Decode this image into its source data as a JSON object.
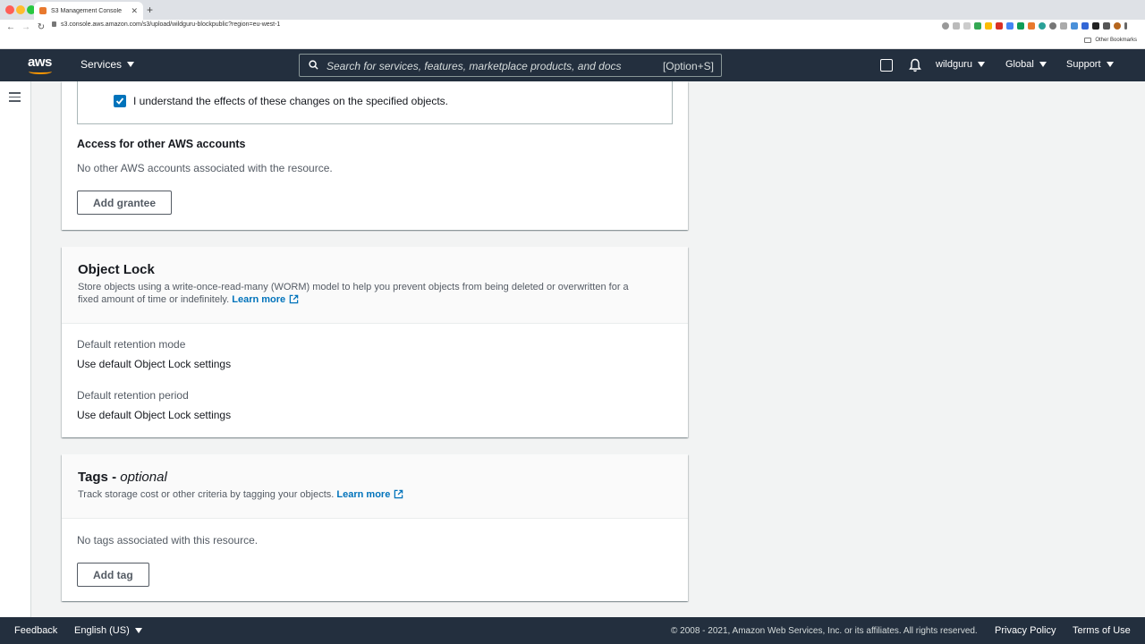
{
  "browser": {
    "tab_title": "S3 Management Console",
    "url": "s3.console.aws.amazon.com/s3/upload/wildguru-blockpublic?region=eu-west-1",
    "bookmarks_label": "Other Bookmarks"
  },
  "aws_nav": {
    "logo_text": "aws",
    "services_label": "Services",
    "search_placeholder": "Search for services, features, marketplace products, and docs",
    "search_shortcut": "[Option+S]",
    "account_label": "wildguru",
    "region_label": "Global",
    "support_label": "Support"
  },
  "acl_section": {
    "ack_checkbox_label": "I understand the effects of these changes on the specified objects.",
    "ack_checked": true,
    "other_accounts_heading": "Access for other AWS accounts",
    "other_accounts_empty": "No other AWS accounts associated with the resource.",
    "add_grantee_label": "Add grantee"
  },
  "object_lock": {
    "title": "Object Lock",
    "description": "Store objects using a write-once-read-many (WORM) model to help you prevent objects from being deleted or overwritten for a fixed amount of time or indefinitely.",
    "learn_more": "Learn more",
    "retention_mode_label": "Default retention mode",
    "retention_mode_value": "Use default Object Lock settings",
    "retention_period_label": "Default retention period",
    "retention_period_value": "Use default Object Lock settings"
  },
  "tags": {
    "title": "Tags - ",
    "title_optional": "optional",
    "description": "Track storage cost or other criteria by tagging your objects.",
    "learn_more": "Learn more",
    "empty": "No tags associated with this resource.",
    "add_tag_label": "Add tag"
  },
  "footer": {
    "feedback": "Feedback",
    "language": "English (US)",
    "copyright": "© 2008 - 2021, Amazon Web Services, Inc. or its affiliates. All rights reserved.",
    "privacy": "Privacy Policy",
    "terms": "Terms of Use"
  },
  "colors": {
    "nav_bg": "#232f3e",
    "accent_orange": "#ff9900",
    "link_blue": "#0073bb",
    "page_bg": "#f2f3f3"
  }
}
